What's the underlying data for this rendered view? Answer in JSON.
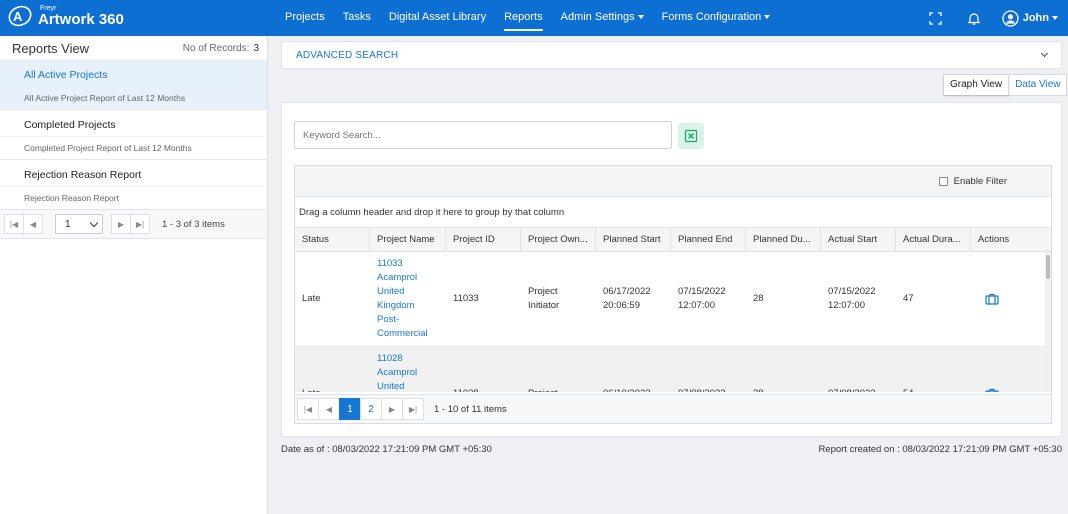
{
  "brand": {
    "small": "Freyr",
    "title": "Artwork 360"
  },
  "nav": [
    {
      "label": "Projects",
      "dropdown": false,
      "active": false
    },
    {
      "label": "Tasks",
      "dropdown": false,
      "active": false
    },
    {
      "label": "Digital Asset Library",
      "dropdown": false,
      "active": false
    },
    {
      "label": "Reports",
      "dropdown": false,
      "active": true
    },
    {
      "label": "Admin Settings",
      "dropdown": true,
      "active": false
    },
    {
      "label": "Forms Configuration",
      "dropdown": true,
      "active": false
    }
  ],
  "user": {
    "name": "John"
  },
  "left_panel": {
    "title": "Reports View",
    "records_label": "No of Records:",
    "records_count": "3",
    "reports": [
      {
        "name": "All Active Projects",
        "description": "All Active Project Report of Last 12 Months",
        "active": true
      },
      {
        "name": "Completed Projects",
        "description": "Completed Project Report of Last 12 Months",
        "active": false
      },
      {
        "name": "Rejection Reason Report",
        "description": "Rejection Reason Report",
        "active": false
      }
    ],
    "pager": {
      "page": "1",
      "info": "1 - 3 of 3 items"
    }
  },
  "advanced_search": {
    "title": "ADVANCED SEARCH"
  },
  "view_toggle": {
    "graph": "Graph View",
    "data": "Data View"
  },
  "search": {
    "placeholder": "Keyword Search..."
  },
  "grid": {
    "enable_filter": "Enable Filter",
    "group_hint": "Drag a column header and drop it here to group by that column",
    "columns": [
      "Status",
      "Project Name",
      "Project ID",
      "Project Own...",
      "Planned Start",
      "Planned End",
      "Planned Du...",
      "Actual Start",
      "Actual Dura...",
      "Actions"
    ],
    "rows": [
      {
        "status": "Late",
        "name_lines": [
          "11033",
          "Acamprol",
          "United",
          "Kingdom",
          "Post-",
          "Commercial"
        ],
        "id": "11033",
        "owner_lines": [
          "Project",
          "Initiator"
        ],
        "planned_start_lines": [
          "06/17/2022",
          "20:06:59"
        ],
        "planned_end_lines": [
          "07/15/2022",
          "12:07:00"
        ],
        "planned_duration": "28",
        "actual_start_lines": [
          "07/15/2022",
          "12:07:00"
        ],
        "actual_duration": "47"
      },
      {
        "status": "Late",
        "name_lines": [
          "11028",
          "Acamprol",
          "United"
        ],
        "id": "11028",
        "owner_lines": [
          "Project"
        ],
        "planned_start_lines": [
          "06/10/2022"
        ],
        "planned_end_lines": [
          "07/08/2022"
        ],
        "planned_duration": "28",
        "actual_start_lines": [
          "07/08/2022"
        ],
        "actual_duration": "54"
      }
    ],
    "pager": {
      "pages": [
        "1",
        "2"
      ],
      "current": "1",
      "info": "1 - 10 of 11 items"
    }
  },
  "footer": {
    "date_as_of": "Date as of : 08/03/2022 17:21:09 PM GMT +05:30",
    "report_created": "Report created on : 08/03/2022 17:21:09 PM GMT +05:30"
  },
  "colors": {
    "nav_bg": "#0d6fd1",
    "accent": "#1677d2",
    "active_row": "#e6f1fc",
    "excel_bg": "#d9f4e6",
    "excel_icon": "#21a366"
  },
  "icons": {
    "expand": "expand-icon",
    "bell": "bell-icon",
    "user": "user-circle-icon",
    "excel": "excel-icon",
    "action": "briefcase-icon"
  }
}
